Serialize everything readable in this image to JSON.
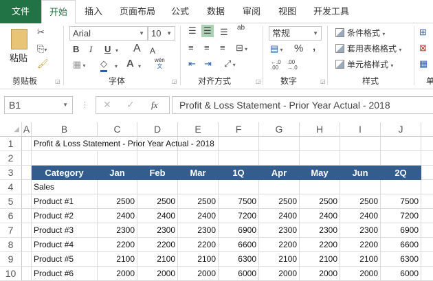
{
  "tabs": [
    {
      "label": "文件"
    },
    {
      "label": "开始"
    },
    {
      "label": "插入"
    },
    {
      "label": "页面布局"
    },
    {
      "label": "公式"
    },
    {
      "label": "数据"
    },
    {
      "label": "审阅"
    },
    {
      "label": "视图"
    },
    {
      "label": "开发工具"
    }
  ],
  "ribbon": {
    "clipboard": {
      "paste": "粘贴",
      "label": "剪贴板"
    },
    "font": {
      "name": "Arial",
      "size": "10",
      "bold": "B",
      "italic": "I",
      "underline": "U",
      "grow": "A",
      "shrink": "A",
      "color": "A",
      "phonetic_top": "wén",
      "phonetic_bottom": "文",
      "label": "字体"
    },
    "alignment": {
      "wrap": "ab",
      "label": "对齐方式"
    },
    "number": {
      "format": "常规",
      "percent": "%",
      "comma": ",",
      "inc_dec": "←.0 .00",
      "dec_dec": ".00 →.0",
      "label": "数字"
    },
    "styles": {
      "conditional": "条件格式",
      "table": "套用表格格式",
      "cell": "单元格样式",
      "label": "样式"
    },
    "cells": {
      "label": "单"
    }
  },
  "formula_bar": {
    "name_box": "B1",
    "cancel": "✕",
    "enter": "✓",
    "fx": "fx",
    "value": "Profit & Loss Statement - Prior Year Actual - 2018"
  },
  "sheet": {
    "columns": [
      "A",
      "B",
      "C",
      "D",
      "E",
      "F",
      "G",
      "H",
      "I",
      "J"
    ],
    "row_numbers": [
      "1",
      "2",
      "3",
      "4",
      "5",
      "6",
      "7",
      "8",
      "9",
      "10"
    ],
    "title": "Profit & Loss Statement - Prior Year Actual - 2018",
    "headers": [
      "Category",
      "Jan",
      "Feb",
      "Mar",
      "1Q",
      "Apr",
      "May",
      "Jun",
      "2Q"
    ],
    "section": "Sales",
    "rows": [
      {
        "label": "Product #1",
        "values": [
          "2500",
          "2500",
          "2500",
          "7500",
          "2500",
          "2500",
          "2500",
          "7500"
        ]
      },
      {
        "label": "Product #2",
        "values": [
          "2400",
          "2400",
          "2400",
          "7200",
          "2400",
          "2400",
          "2400",
          "7200"
        ]
      },
      {
        "label": "Product #3",
        "values": [
          "2300",
          "2300",
          "2300",
          "6900",
          "2300",
          "2300",
          "2300",
          "6900"
        ]
      },
      {
        "label": "Product #4",
        "values": [
          "2200",
          "2200",
          "2200",
          "6600",
          "2200",
          "2200",
          "2200",
          "6600"
        ]
      },
      {
        "label": "Product #5",
        "values": [
          "2100",
          "2100",
          "2100",
          "6300",
          "2100",
          "2100",
          "2100",
          "6300"
        ]
      },
      {
        "label": "Product #6",
        "values": [
          "2000",
          "2000",
          "2000",
          "6000",
          "2000",
          "2000",
          "2000",
          "6000"
        ]
      }
    ]
  },
  "colors": {
    "file_tab": "#217346",
    "header_fill": "#345c8c"
  }
}
